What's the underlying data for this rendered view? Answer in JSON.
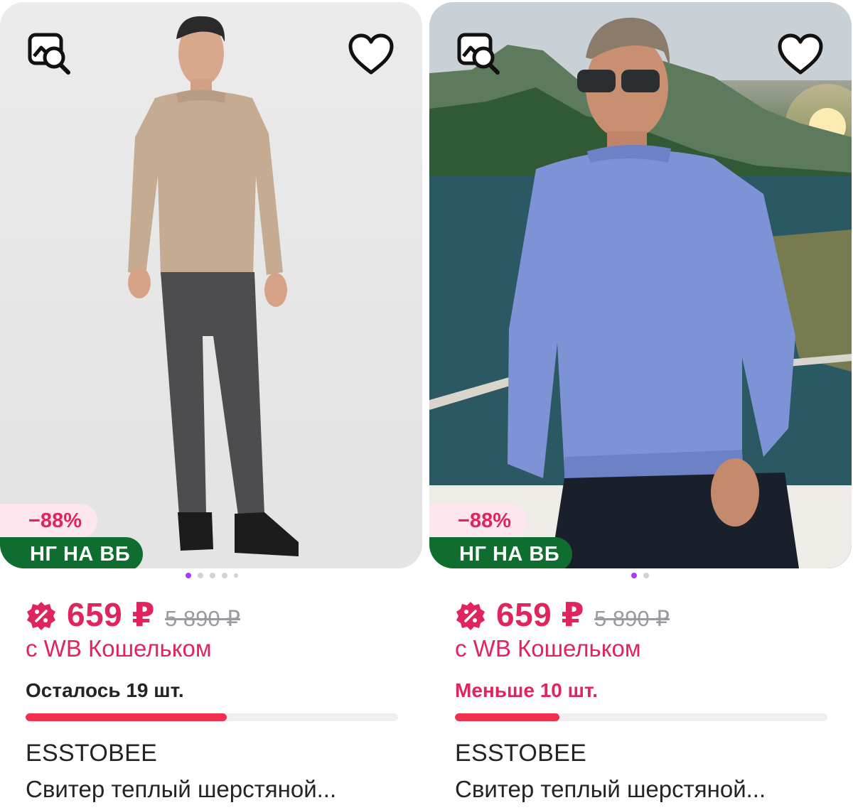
{
  "colors": {
    "accent": "#e0245e",
    "discount_badge_bg": "#fde6ee",
    "promo_badge_bg": "#0f6e2f",
    "stock_bar_fill": "#f1304f",
    "stock_bar_track": "#efeff2",
    "dot_active": "#a73afd",
    "dot_inactive": "#d2d2d6"
  },
  "products": [
    {
      "discount_badge": "−88%",
      "promo_badge": "НГ НА ВБ",
      "price": "659 ₽",
      "old_price": "5 890 ₽",
      "wallet_label": "с WB Кошельком",
      "stock_text": "Осталось 19 шт.",
      "stock_level": 0.54,
      "brand": "ESSTOBEE",
      "title": "Свитер теплый шерстяной...",
      "photo_count": 5,
      "active_photo": 0,
      "icons": [
        "similar-search-icon",
        "heart-icon",
        "wallet-discount-icon"
      ]
    },
    {
      "discount_badge": "−88%",
      "promo_badge": "НГ НА ВБ",
      "price": "659 ₽",
      "old_price": "5 890 ₽",
      "wallet_label": "с WB Кошельком",
      "stock_text": "Меньше 10 шт.",
      "stock_level": 0.28,
      "brand": "ESSTOBEE",
      "title": "Свитер теплый шерстяной...",
      "photo_count": 2,
      "active_photo": 0,
      "icons": [
        "similar-search-icon",
        "heart-icon",
        "wallet-discount-icon"
      ]
    }
  ]
}
